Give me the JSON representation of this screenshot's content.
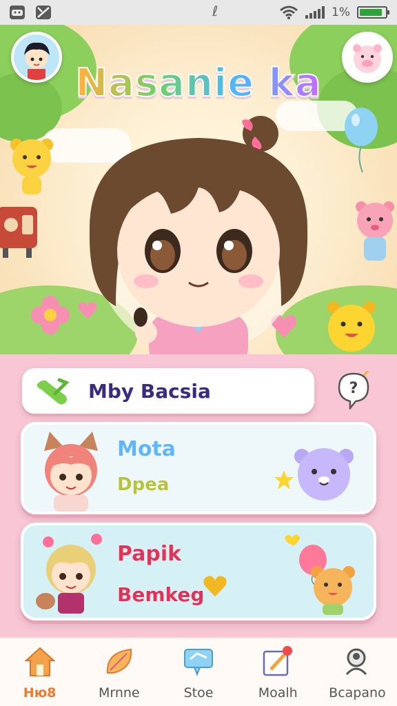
{
  "status_bar": {
    "center_glyph": "ℓ",
    "battery_text": "1%",
    "battery_level": 0.9,
    "icons": [
      "discord-icon",
      "gallery-icon",
      "wifi-icon",
      "signal-icon",
      "battery-icon"
    ]
  },
  "header": {
    "title": "Nasanie ka",
    "left_avatar_icon": "boy-avatar-icon",
    "right_avatar_icon": "pig-mascot-icon"
  },
  "hero": {
    "character_icon": "chibi-girl-character",
    "decorations": [
      "bear-mascot-icon",
      "radio-icon",
      "balloon-icon",
      "pink-bear-icon",
      "yellow-bear-icon",
      "flower-icon",
      "heart-icon"
    ]
  },
  "search": {
    "label": "Mby Bacsia",
    "icon": "green-brush-icon",
    "help_icon": "question-bubble-icon"
  },
  "cards": [
    {
      "name_primary": "Mota",
      "name_secondary": "Dpea",
      "avatar_icon": "fox-girl-avatar",
      "mascot_icon": "purple-bear-icon",
      "extra_icon": "star-icon"
    },
    {
      "name_primary": "Papik",
      "name_secondary": "Bemkeg",
      "avatar_icon": "cat-boy-avatar",
      "mascot_icon": "orange-bear-icon",
      "extra_icon": "heart-balloon-icon"
    }
  ],
  "bottom_nav": [
    {
      "label": "Hю8",
      "icon": "home-icon",
      "active": true
    },
    {
      "label": "Mrnne",
      "icon": "leaf-icon",
      "active": false
    },
    {
      "label": "Stoe",
      "icon": "chat-icon",
      "active": false
    },
    {
      "label": "Moalh",
      "icon": "edit-icon",
      "active": false
    },
    {
      "label": "Bcapano",
      "icon": "search-person-icon",
      "active": false
    }
  ],
  "colors": {
    "accent": "#ef7a2d",
    "content_bg": "#f8c6d4",
    "search_text": "#3a2a80",
    "card1_bg": "#eef8fb",
    "card2_bg": "#d6f1f6"
  }
}
